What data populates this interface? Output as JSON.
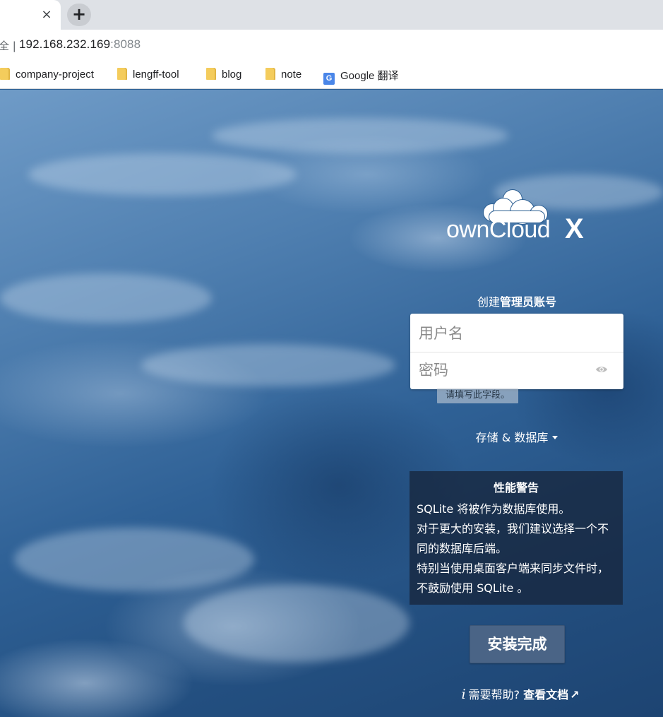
{
  "browser": {
    "tab_close": "×",
    "new_tab": "+",
    "security_fragment": "全 |",
    "url_host": "192.168.232.169",
    "url_port": ":8088",
    "bookmarks": [
      {
        "label": "company-project",
        "icon": "folder-icon"
      },
      {
        "label": "lengff-tool",
        "icon": "folder-icon"
      },
      {
        "label": "blog",
        "icon": "folder-icon"
      },
      {
        "label": "note",
        "icon": "folder-icon"
      },
      {
        "label": "Google 翻译",
        "icon": "google-translate-icon"
      }
    ]
  },
  "logo": {
    "text": "ownCloud",
    "x": "X"
  },
  "form": {
    "title_prefix": "创建",
    "title_bold": "管理员账号",
    "username_placeholder": "用户名",
    "password_placeholder": "密码",
    "tooltip": "请填写此字段。",
    "storage_label": "存储 & 数据库"
  },
  "warning": {
    "title": "性能警告",
    "line1": "SQLite 将被作为数据库使用。",
    "line2": "对于更大的安装，我们建议选择一个不同的数据库后端。",
    "line3": "特别当使用桌面客户端来同步文件时，不鼓励使用 SQLite 。"
  },
  "install_button": "安装完成",
  "help": {
    "info_glyph": "i",
    "prefix": "需要帮助?",
    "link": "查看文档",
    "arrow": "↗"
  },
  "colors": {
    "background": "#2d5f92",
    "button": "#4a6486",
    "warning_bg": "#162337"
  }
}
